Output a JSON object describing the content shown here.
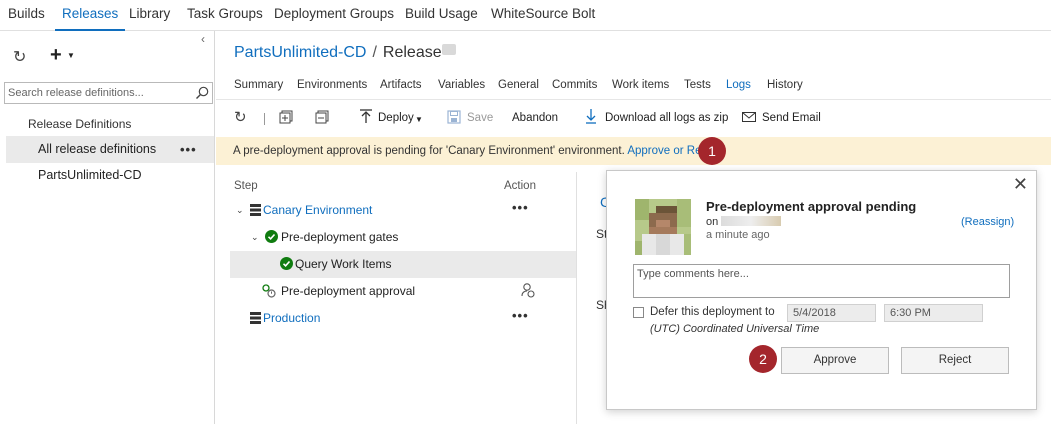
{
  "topnav": {
    "tabs": [
      {
        "label": "Builds"
      },
      {
        "label": "Releases"
      },
      {
        "label": "Library"
      },
      {
        "label": "Task Groups"
      },
      {
        "label": "Deployment Groups"
      },
      {
        "label": "Build Usage"
      },
      {
        "label": "WhiteSource Bolt"
      }
    ],
    "active": "Releases"
  },
  "sidebar": {
    "search_placeholder": "Search release definitions...",
    "section_title": "Release Definitions",
    "items": [
      {
        "label": "All release definitions",
        "selected": true
      },
      {
        "label": "PartsUnlimited-CD",
        "selected": false
      }
    ],
    "more_label": "•••"
  },
  "header": {
    "definition": "PartsUnlimited-CD",
    "separator": "/",
    "release_label": "Release"
  },
  "subtabs": [
    {
      "label": "Summary"
    },
    {
      "label": "Environments"
    },
    {
      "label": "Artifacts"
    },
    {
      "label": "Variables"
    },
    {
      "label": "General"
    },
    {
      "label": "Commits"
    },
    {
      "label": "Work items"
    },
    {
      "label": "Tests"
    },
    {
      "label": "Logs"
    },
    {
      "label": "History"
    }
  ],
  "active_subtab": "Logs",
  "toolbar": {
    "deploy": "Deploy",
    "save": "Save",
    "abandon": "Abandon",
    "download_logs": "Download all logs as zip",
    "send_email": "Send Email"
  },
  "banner": {
    "text": "A pre-deployment approval is pending for 'Canary Environment' environment.",
    "link": "Approve or Reject",
    "callout": "1"
  },
  "steps": {
    "step_header": "Step",
    "action_header": "Action",
    "rows": [
      {
        "label": "Canary Environment"
      },
      {
        "label": "Pre-deployment gates"
      },
      {
        "label": "Query Work Items"
      },
      {
        "label": "Pre-deployment approval"
      },
      {
        "label": "Production"
      }
    ],
    "more": "•••"
  },
  "behind": {
    "frag1": "C",
    "frag2": "St",
    "frag3": "Sh"
  },
  "popup": {
    "title": "Pre-deployment approval pending",
    "on_prefix": "on",
    "time": "a minute ago",
    "reassign": "(Reassign)",
    "comments_placeholder": "Type comments here...",
    "defer_label": "Defer this deployment to",
    "defer_date": "5/4/2018",
    "defer_time": "6:30 PM",
    "timezone": "(UTC) Coordinated Universal Time",
    "approve": "Approve",
    "reject": "Reject",
    "callout": "2"
  },
  "colors": {
    "accent": "#106ebe",
    "banner_bg": "#fcf1d5",
    "callout": "#a4262c",
    "success": "#107c10"
  }
}
